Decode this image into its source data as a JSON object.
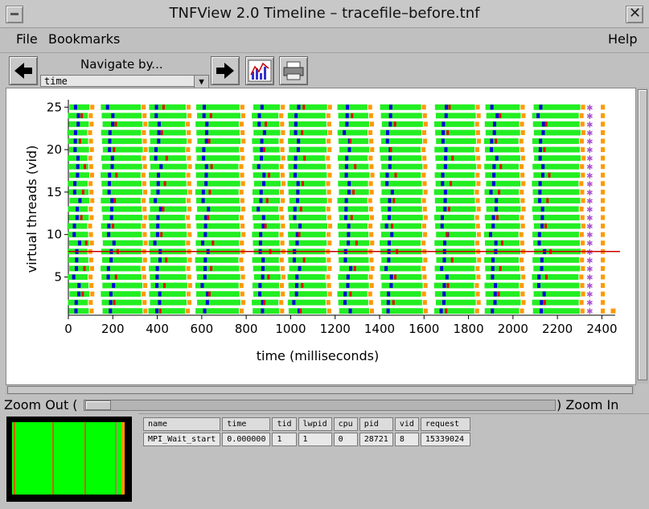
{
  "window": {
    "title": "TNFView 2.0 Timeline – tracefile–before.tnf"
  },
  "menu": {
    "file": "File",
    "bookmarks": "Bookmarks",
    "help": "Help"
  },
  "toolbar": {
    "navigate_label": "Navigate by...",
    "navigate_value": "time"
  },
  "chart_data": {
    "type": "scatter",
    "xlabel": "time (milliseconds)",
    "ylabel": "virtual threads (vid)",
    "xlim": [
      0,
      2460
    ],
    "ylim": [
      0.5,
      25.5
    ],
    "xticks": [
      0,
      200,
      400,
      600,
      800,
      1000,
      1200,
      1400,
      1600,
      1800,
      2000,
      2200,
      2400
    ],
    "yticks": [
      5,
      10,
      15,
      20,
      25
    ],
    "threads": 25,
    "segments": [
      [
        0,
        90
      ],
      [
        150,
        330
      ],
      [
        365,
        530
      ],
      [
        575,
        770
      ],
      [
        830,
        950
      ],
      [
        990,
        1160
      ],
      [
        1215,
        1350
      ],
      [
        1405,
        1590
      ],
      [
        1650,
        1830
      ],
      [
        1875,
        2030
      ],
      [
        2090,
        2300
      ]
    ],
    "colors": {
      "compute": "#22ee22",
      "send": "#0000dd",
      "wait": "#ee0000",
      "boundary": "#ff9900",
      "star": "#aa55cc",
      "selection": "#cc0000"
    },
    "selected_vid": 8,
    "grid": false
  },
  "zoom": {
    "out_label": "Zoom Out (",
    "in_label": ") Zoom In"
  },
  "event_table": {
    "headers": [
      "name",
      "time",
      "tid",
      "lwpid",
      "cpu",
      "pid",
      "vid",
      "request"
    ],
    "rows": [
      [
        "MPI_Wait_start",
        "0.000000",
        "1",
        "1",
        "0",
        "28721",
        "8",
        "15339024"
      ]
    ]
  }
}
